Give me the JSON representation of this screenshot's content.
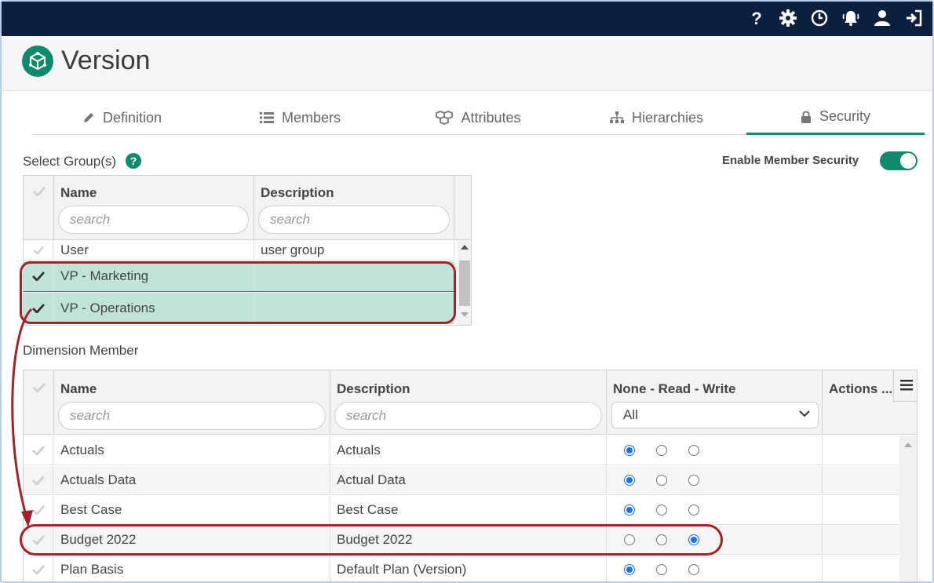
{
  "topbar": {
    "icons": [
      "help-icon",
      "settings-gear-icon",
      "history-clock-icon",
      "notifications-bell-icon",
      "user-profile-icon",
      "sign-out-icon"
    ]
  },
  "header": {
    "title": "Version",
    "logo_icon": "version-cube-icon"
  },
  "tabs": [
    {
      "label": "Definition",
      "icon": "pencil-icon"
    },
    {
      "label": "Members",
      "icon": "list-icon"
    },
    {
      "label": "Attributes",
      "icon": "cubes-icon"
    },
    {
      "label": "Hierarchies",
      "icon": "sitemap-icon"
    },
    {
      "label": "Security",
      "icon": "lock-icon",
      "active": true
    }
  ],
  "groups": {
    "label": "Select Group(s)",
    "help": "?",
    "enable_security_label": "Enable Member Security",
    "enable_security_on": true,
    "columns": {
      "name": "Name",
      "description": "Description"
    },
    "search_placeholder": "search",
    "rows": [
      {
        "name": "User",
        "description": "user group",
        "selected": false
      },
      {
        "name": "VP - Marketing",
        "description": "",
        "selected": true
      },
      {
        "name": "VP - Operations",
        "description": "",
        "selected": true
      }
    ]
  },
  "members": {
    "label": "Dimension Member",
    "columns": {
      "name": "Name",
      "description": "Description",
      "access": "None - Read - Write",
      "actions": "Actions ..."
    },
    "search_placeholder": "search",
    "access_filter": "All",
    "rows": [
      {
        "name": "Actuals",
        "description": "Actuals",
        "access": "None"
      },
      {
        "name": "Actuals Data",
        "description": "Actual Data",
        "access": "None"
      },
      {
        "name": "Best Case",
        "description": "Best Case",
        "access": "None"
      },
      {
        "name": "Budget 2022",
        "description": "Budget 2022",
        "access": "Write"
      },
      {
        "name": "Plan Basis",
        "description": "Default Plan (Version)",
        "access": "None"
      }
    ]
  },
  "colors": {
    "accent": "#0f8a6e",
    "topbar": "#0c1f3f",
    "selected_row": "#c2e3d9",
    "annotation": "#a3222a",
    "radio_on": "#1a73e8"
  }
}
